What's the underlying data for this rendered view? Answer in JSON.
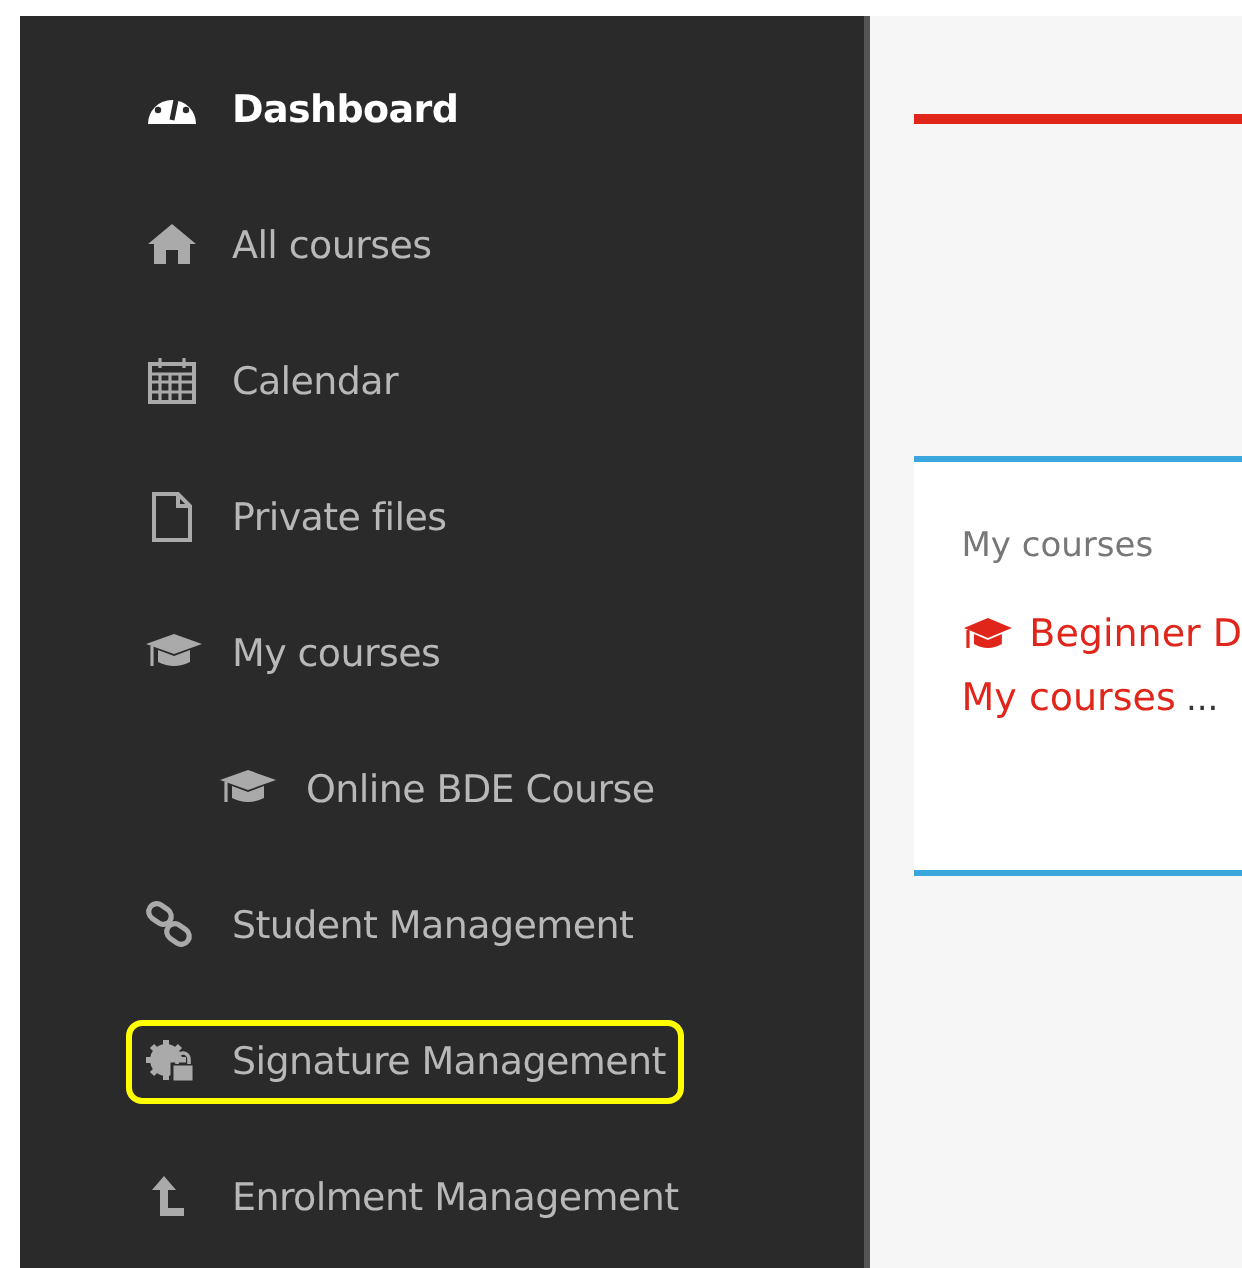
{
  "sidebar": {
    "items": [
      {
        "label": "Dashboard",
        "kind": "dashboard",
        "selected": true,
        "highlighted": false
      },
      {
        "label": "All courses",
        "kind": "home",
        "selected": false,
        "highlighted": false
      },
      {
        "label": "Calendar",
        "kind": "calendar",
        "selected": false,
        "highlighted": false
      },
      {
        "label": "Private files",
        "kind": "file",
        "selected": false,
        "highlighted": false
      },
      {
        "label": "My courses",
        "kind": "cap",
        "selected": false,
        "highlighted": false,
        "children": [
          {
            "label": "Online BDE Course",
            "kind": "cap",
            "selected": false,
            "highlighted": false
          }
        ]
      },
      {
        "label": "Student Management",
        "kind": "link",
        "selected": false,
        "highlighted": false
      },
      {
        "label": "Signature Management",
        "kind": "cog-lock",
        "selected": false,
        "highlighted": true
      },
      {
        "label": "Enrolment Management",
        "kind": "arrow-up",
        "selected": false,
        "highlighted": false
      }
    ]
  },
  "card": {
    "title": "My courses",
    "course_link": "Beginner D",
    "more_link": "My courses",
    "ellipsis": "..."
  }
}
